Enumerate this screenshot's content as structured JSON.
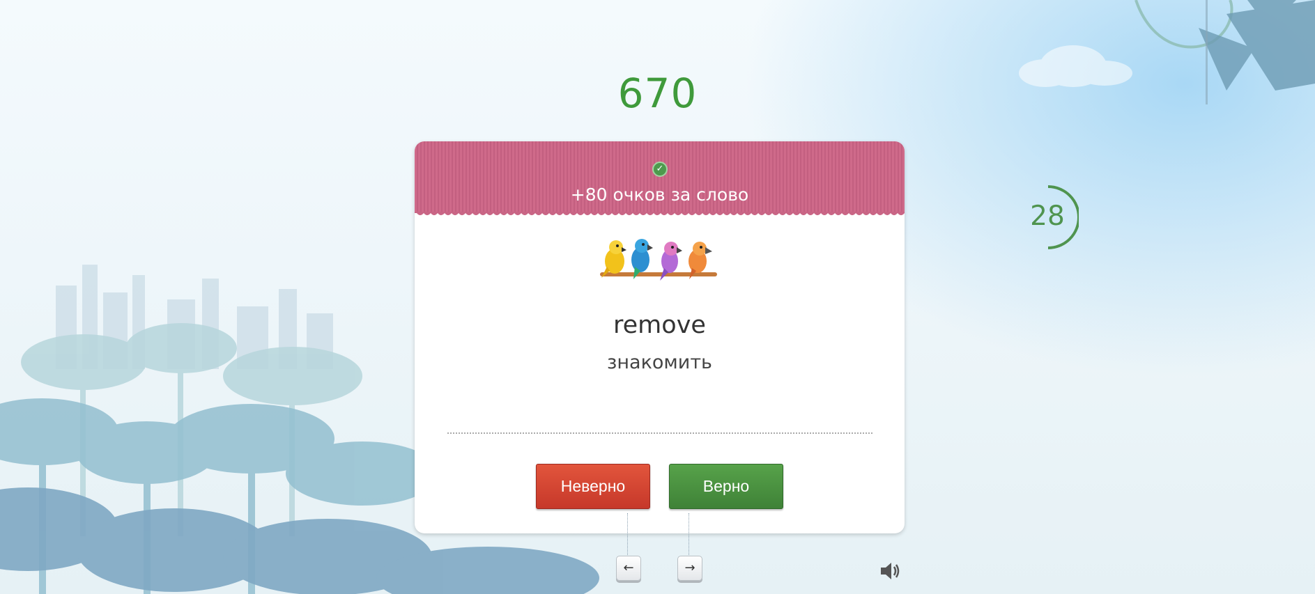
{
  "score": "670",
  "card": {
    "points_message": "+80 очков за слово",
    "word": "remove",
    "translation": "знакомить"
  },
  "buttons": {
    "wrong_label": "Неверно",
    "correct_label": "Верно"
  },
  "keys": {
    "left": "←",
    "right": "→"
  },
  "timer": {
    "seconds": "28"
  },
  "icons": {
    "check": "check-circle-icon",
    "sound": "speaker-icon",
    "illustration": "parrots-on-perch"
  },
  "colors": {
    "score": "#3f9a3b",
    "header": "#cf6a8a",
    "wrong_button": "#d5462f",
    "correct_button": "#4b9140",
    "timer": "#4f944f"
  }
}
